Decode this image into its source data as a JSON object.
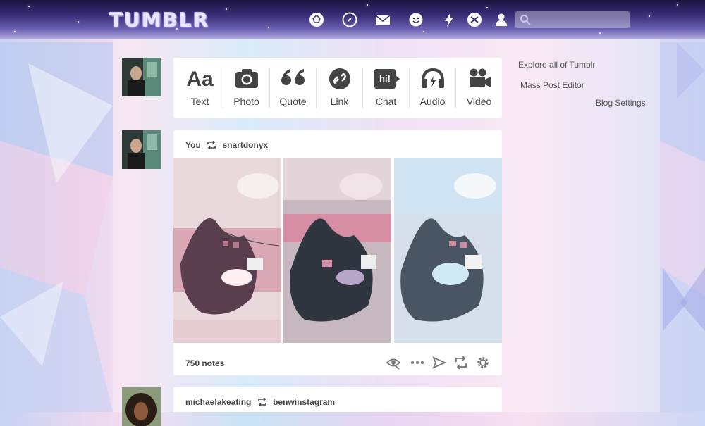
{
  "header": {
    "logo": "TUMBLR",
    "search": {
      "value": "",
      "placeholder": ""
    },
    "nav_icons": [
      "dashboard-icon",
      "explore-icon",
      "inbox-icon",
      "messaging-icon",
      "activity-icon",
      "xkit-icon",
      "account-icon"
    ]
  },
  "composer": {
    "types": [
      {
        "label": "Text",
        "icon": "text-icon"
      },
      {
        "label": "Photo",
        "icon": "camera-icon"
      },
      {
        "label": "Quote",
        "icon": "quote-icon"
      },
      {
        "label": "Link",
        "icon": "link-icon"
      },
      {
        "label": "Chat",
        "icon": "chat-icon",
        "icon_text": "hi!"
      },
      {
        "label": "Audio",
        "icon": "headphones-icon"
      },
      {
        "label": "Video",
        "icon": "video-camera-icon"
      }
    ],
    "text_glyph": "Aa"
  },
  "posts": [
    {
      "author": "You",
      "reblogged_from": "snartdonyx",
      "notes": "750 notes",
      "actions": [
        "seen-icon",
        "more-icon",
        "share-icon",
        "reblog-icon",
        "settings-icon"
      ]
    },
    {
      "author": "michaelakeating",
      "reblogged_from": "benwinstagram"
    }
  ],
  "sidebar": {
    "links": [
      "Explore all of Tumblr",
      "Mass Post Editor",
      "Blog Settings"
    ]
  },
  "colors": {
    "header_top": "#1a1440",
    "card": "#ffffff",
    "text": "#444444",
    "accent_bg": "#e9d4f2"
  }
}
